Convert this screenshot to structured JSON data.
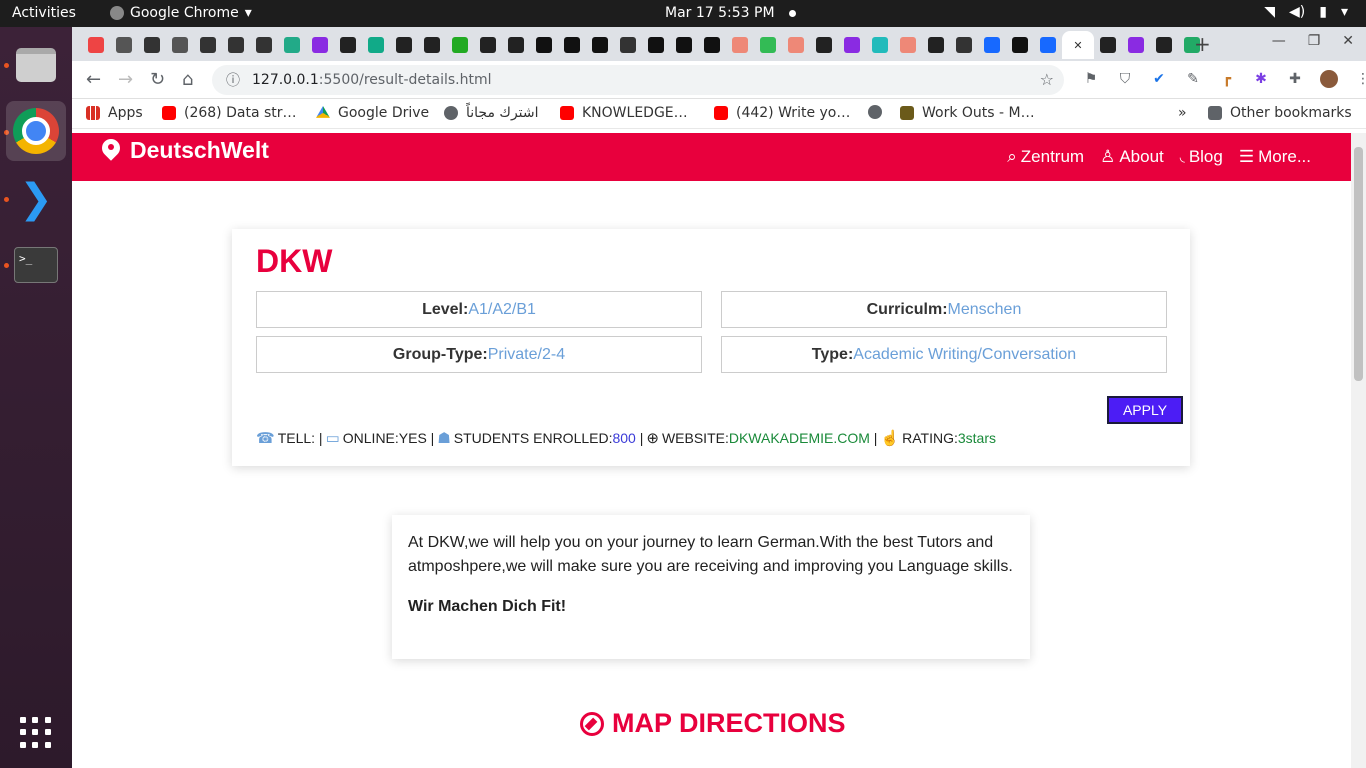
{
  "os": {
    "activities": "Activities",
    "app_name": "Google Chrome",
    "clock": "Mar 17  5:53 PM"
  },
  "browser": {
    "url_host": "127.0.0.1",
    "url_path": ":5500/result-details.html",
    "bookmarks": [
      {
        "label": "Apps",
        "icon": "apps-grid-icon"
      },
      {
        "label": "(268) Data str…",
        "icon": "youtube-icon"
      },
      {
        "label": "Google Drive",
        "icon": "google-drive-icon"
      },
      {
        "label": "اشترك مجاناً",
        "icon": "globe-icon"
      },
      {
        "label": "KNOWLEDGE…",
        "icon": "youtube-icon"
      },
      {
        "label": "(442) Write yo…",
        "icon": "youtube-icon"
      },
      {
        "label": "",
        "icon": "globe-icon"
      },
      {
        "label": "Work Outs - M…",
        "icon": "workout-icon"
      }
    ],
    "bookmarks_overflow": "»",
    "other_bookmarks": "Other bookmarks"
  },
  "site": {
    "brand": "DeutschWelt",
    "nav": [
      {
        "label": "Zentrum",
        "icon": "search-icon"
      },
      {
        "label": "About",
        "icon": "user-icon"
      },
      {
        "label": "Blog",
        "icon": "rss-icon"
      },
      {
        "label": "More...",
        "icon": "menu-icon"
      }
    ]
  },
  "details": {
    "title": "DKW",
    "level_label": "Level:",
    "level_value": "A1/A2/B1",
    "curriculum_label": "Curriculm:",
    "curriculum_value": "Menschen",
    "group_label": "Group-Type:",
    "group_value": "Private/2-4",
    "type_label": "Type:",
    "type_value": "Academic Writing/Conversation",
    "apply_label": "APPLY",
    "tell_label": "TELL: |",
    "online_label": "ONLINE:YES |",
    "students_label": "STUDENTS ENROLLED:",
    "students_value": "800",
    "website_label": "WEBSITE:",
    "website_value": "DKWAKADEMIE.COM",
    "rating_label": "RATING:",
    "rating_value": "3stars"
  },
  "about": {
    "text": "At DKW,we will help you on your journey to learn German.With the best Tutors and atmposhpere,we will make sure you are receiving and improving you Language skills.",
    "motto": "Wir Machen Dich Fit!"
  },
  "map": {
    "heading": "MAP DIRECTIONS"
  },
  "colors": {
    "brand_red": "#e8003d",
    "link_blue": "#6a9fd8",
    "apply_purple": "#4c1df5"
  }
}
